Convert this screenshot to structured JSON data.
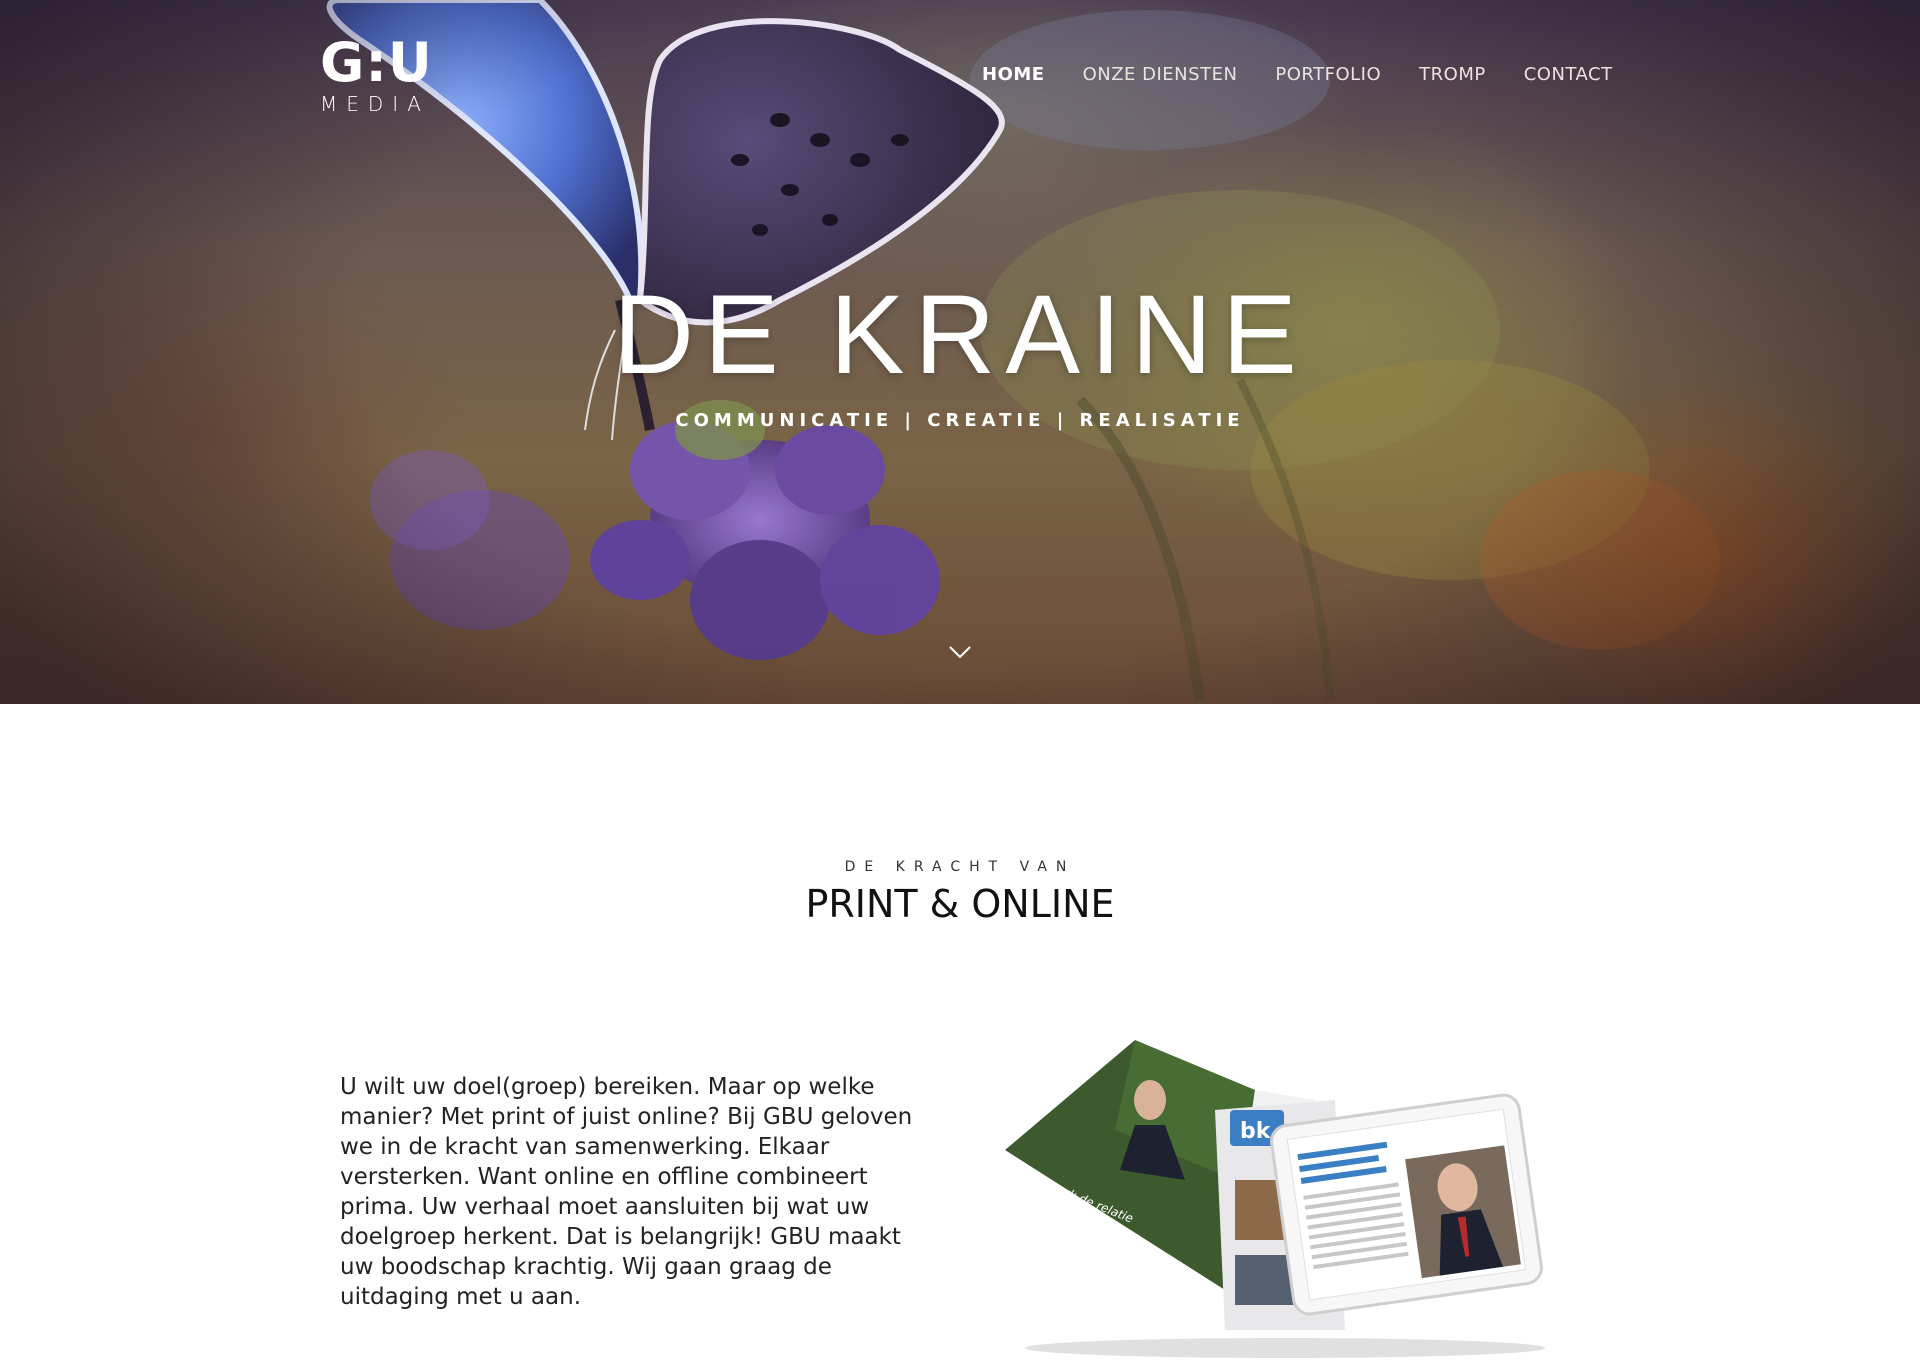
{
  "logo": {
    "mark": "G:U",
    "sub": "MEDIA"
  },
  "nav": {
    "items": [
      {
        "label": "HOME",
        "active": true
      },
      {
        "label": "ONZE DIENSTEN",
        "active": false
      },
      {
        "label": "PORTFOLIO",
        "active": false
      },
      {
        "label": "TROMP",
        "active": false
      },
      {
        "label": "CONTACT",
        "active": false
      }
    ]
  },
  "hero": {
    "title": "DE KRAINE",
    "subtitle": "COMMUNICATIE | CREATIE | REALISATIE",
    "scroll_icon": "chevron-down-icon"
  },
  "section": {
    "kicker": "DE KRACHT VAN",
    "title": "PRINT & ONLINE",
    "body": "U wilt uw doel(groep) bereiken. Maar op welke manier? Met print of juist online? Bij GBU geloven we in de kracht van samenwerking. Elkaar versterken. Want online en offline combineert prima. Uw verhaal moet aansluiten bij wat uw doelgroep herkent. Dat is belangrijk! GBU maakt uw boodschap krachtig. Wij gaan graag de uitdaging met u aan."
  },
  "mockup": {
    "badge": "bk",
    "quote": "'Versterk de relatie tussen bedrijfsleven en onderzoekswereld'"
  },
  "colors": {
    "hero_dark": "#4a3c52",
    "butterfly_blue": "#5b7ed8",
    "flower_purple": "#6a4aa0",
    "badge_blue": "#3a7fc4"
  }
}
